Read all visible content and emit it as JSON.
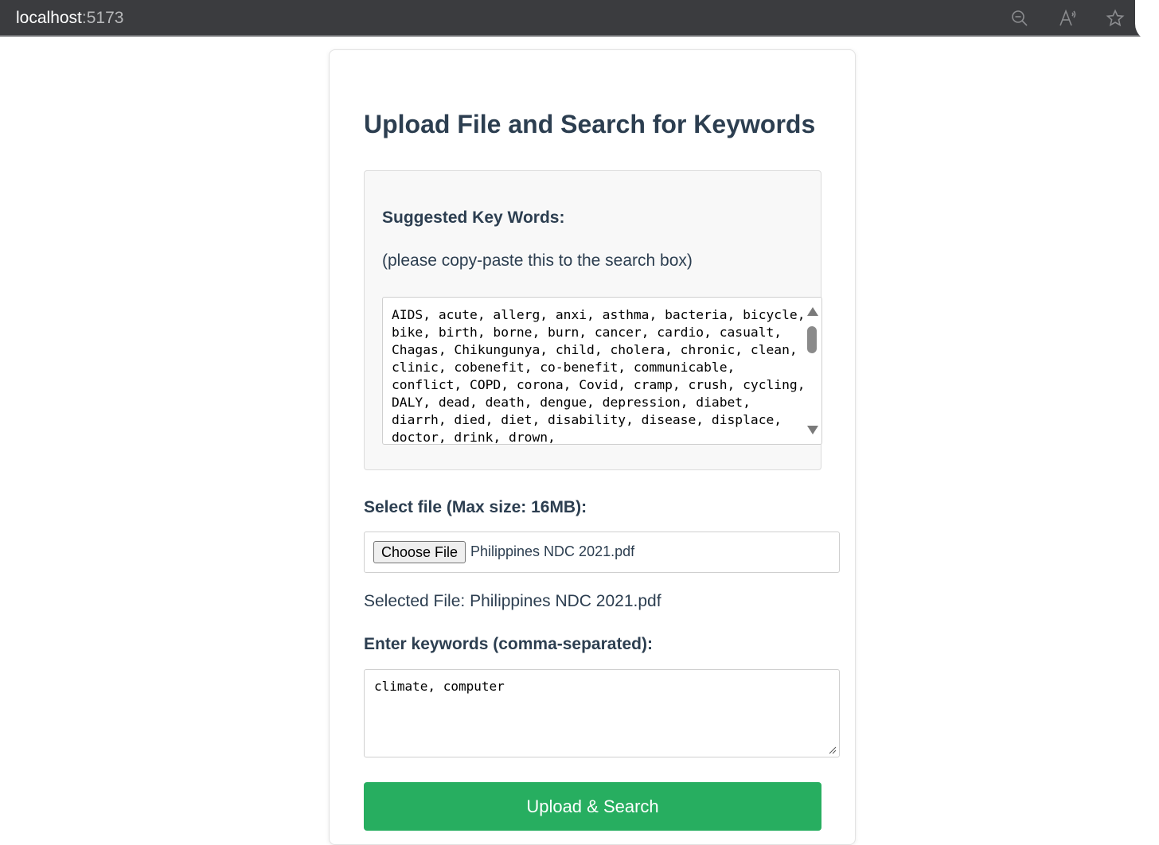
{
  "browser": {
    "host": "localhost",
    "port": ":5173",
    "icons": [
      "zoom-out-icon",
      "read-aloud-icon",
      "favorite-star-icon"
    ]
  },
  "page": {
    "title": "Upload File and Search for Keywords",
    "suggested": {
      "heading": "Suggested Key Words:",
      "note": "(please copy-paste this to the search box)",
      "keywords": "AIDS, acute, allerg, anxi, asthma, bacteria, bicycle, bike, birth, borne, burn, cancer, cardio, casualt, Chagas, Chikungunya, child, cholera, chronic, clean, clinic, cobenefit, co-benefit, communicable, conflict, COPD, corona, Covid, cramp, crush, cycling, DALY, dead, death, dengue, depression, diabet, diarrh, died, diet, disability, disease, displace, doctor, drink, drown,"
    },
    "file": {
      "label": "Select file (Max size: 16MB):",
      "button_label": "Choose File",
      "file_name": "Philippines NDC 2021.pdf",
      "selected_text": "Selected File: Philippines NDC 2021.pdf"
    },
    "keywords_input": {
      "label": "Enter keywords (comma-separated):",
      "value": "climate, computer"
    },
    "submit_label": "Upload & Search"
  },
  "colors": {
    "browser_bar": "#3b3c3f",
    "text": "#2c3e50",
    "submit_button": "#27ae60"
  }
}
